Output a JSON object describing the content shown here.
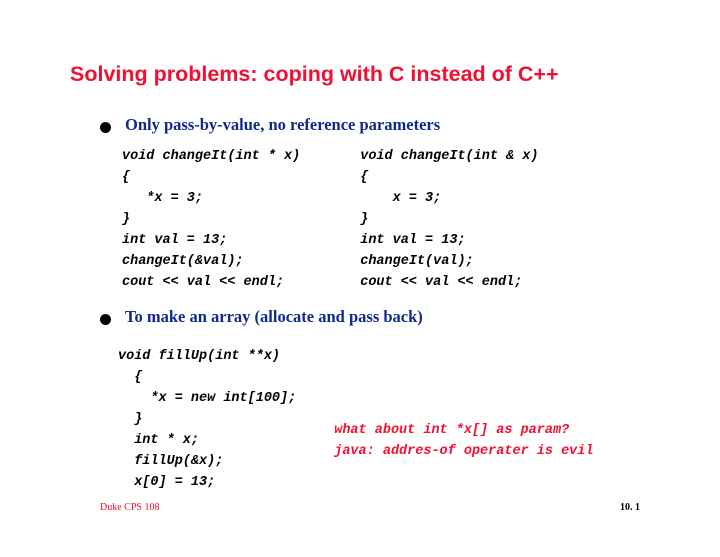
{
  "title": "Solving problems: coping with C instead of C++",
  "bullets": [
    {
      "text": "Only pass-by-value, no reference parameters"
    },
    {
      "text": "To make an array (allocate and pass back)"
    }
  ],
  "code1": {
    "left": "void changeIt(int * x)\n{\n   *x = 3;\n}\nint val = 13;\nchangeIt(&val);\ncout << val << endl;",
    "right": "void changeIt(int & x)\n{\n    x = 3;\n}\nint val = 13;\nchangeIt(val);\ncout << val << endl;"
  },
  "code2": {
    "left": "void fillUp(int **x)\n  {\n    *x = new int[100];\n  }\n  int * x;\n  fillUp(&x);\n  x[0] = 13;",
    "side_top_pad": "\n\n\n\n",
    "side1": "what about int *x[] as param?",
    "side2": "java: addres-of operater is evil"
  },
  "footer": {
    "left": "Duke CPS 108",
    "right": "10. 1"
  }
}
